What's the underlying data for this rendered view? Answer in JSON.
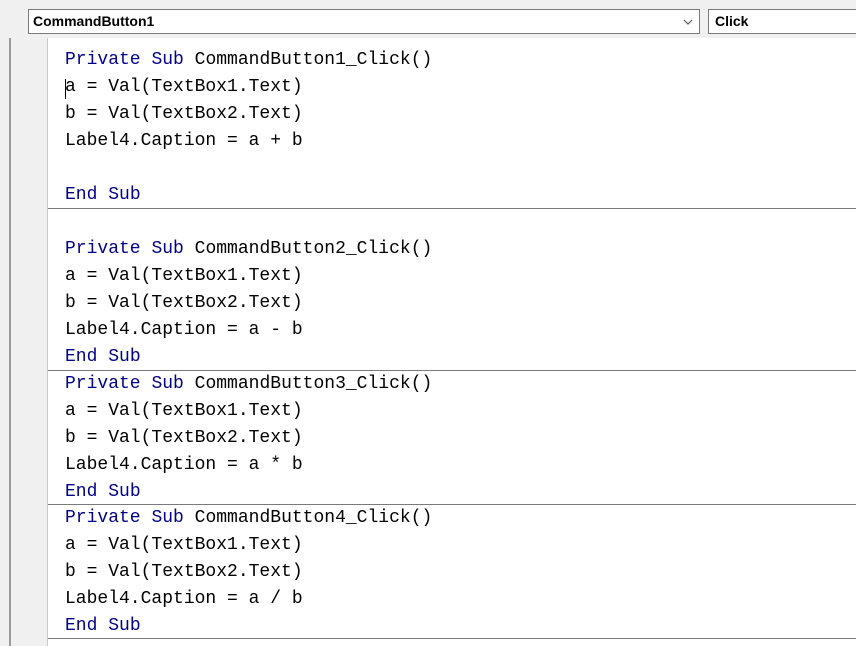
{
  "toolbar": {
    "object_combo": {
      "value": "CommandButton1",
      "arrow_icon": "chevron-down-icon"
    },
    "procedure_combo": {
      "value": "Click"
    }
  },
  "editor": {
    "keyword_color": "#00008b",
    "procedures": [
      {
        "declaration": {
          "keyword1": "Private",
          "keyword2": "Sub",
          "name": "CommandButton1_Click()"
        },
        "body": [
          "a = Val(TextBox1.Text)",
          "b = Val(TextBox2.Text)",
          "Label4.Caption = a + b",
          ""
        ],
        "end": {
          "keyword1": "End",
          "keyword2": "Sub"
        }
      },
      {
        "declaration": {
          "keyword1": "Private",
          "keyword2": "Sub",
          "name": "CommandButton2_Click()"
        },
        "body": [
          "a = Val(TextBox1.Text)",
          "b = Val(TextBox2.Text)",
          "Label4.Caption = a - b"
        ],
        "end": {
          "keyword1": "End",
          "keyword2": "Sub"
        }
      },
      {
        "declaration": {
          "keyword1": "Private",
          "keyword2": "Sub",
          "name": "CommandButton3_Click()"
        },
        "body": [
          "a = Val(TextBox1.Text)",
          "b = Val(TextBox2.Text)",
          "Label4.Caption = a * b"
        ],
        "end": {
          "keyword1": "End",
          "keyword2": "Sub"
        }
      },
      {
        "declaration": {
          "keyword1": "Private",
          "keyword2": "Sub",
          "name": "CommandButton4_Click()"
        },
        "body": [
          "a = Val(TextBox1.Text)",
          "b = Val(TextBox2.Text)",
          "Label4.Caption = a / b"
        ],
        "end": {
          "keyword1": "End",
          "keyword2": "Sub"
        }
      }
    ]
  }
}
